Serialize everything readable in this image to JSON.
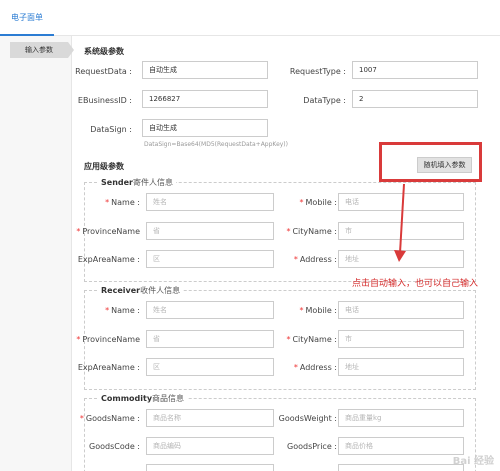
{
  "topbar": {
    "tab": "电子面单"
  },
  "leftnav": {
    "item": "输入参数"
  },
  "system": {
    "title": "系统级参数",
    "requestdata_label": "RequestData :",
    "requestdata_value": "自动生成",
    "requesttype_label": "RequestType :",
    "requesttype_value": "1007",
    "ebusinessid_label": "EBusinessID :",
    "ebusinessid_value": "1266827",
    "datatype_label": "DataType :",
    "datatype_value": "2",
    "datasign_label": "DataSign :",
    "datasign_value": "自动生成",
    "datasign_hint": "DataSign=Base64(MD5(RequestData+AppKey))"
  },
  "app": {
    "title": "应用级参数",
    "random_button": "随机填入参数"
  },
  "sender": {
    "legend_bold": "Sender",
    "legend_rest": "寄件人信息",
    "name_label": "Name :",
    "name_placeholder": "姓名",
    "mobile_label": "Mobile :",
    "mobile_placeholder": "电话",
    "province_label": "ProvinceName",
    "province_placeholder": "省",
    "city_label": "CityName :",
    "city_placeholder": "市",
    "exparea_label": "ExpAreaName :",
    "exparea_placeholder": "区",
    "address_label": "Address :",
    "address_placeholder": "地址"
  },
  "receiver": {
    "legend_bold": "Receiver",
    "legend_rest": "收件人信息",
    "name_label": "Name :",
    "name_placeholder": "姓名",
    "mobile_label": "Mobile :",
    "mobile_placeholder": "电话",
    "province_label": "ProvinceName",
    "province_placeholder": "省",
    "city_label": "CityName :",
    "city_placeholder": "市",
    "exparea_label": "ExpAreaName :",
    "exparea_placeholder": "区",
    "address_label": "Address :",
    "address_placeholder": "地址"
  },
  "commodity": {
    "legend_bold": "Commodity",
    "legend_rest": "商品信息",
    "goodsname_label": "GoodsName :",
    "goodsname_placeholder": "商品名称",
    "goodsweight_label": "GoodsWeight :",
    "goodsweight_placeholder": "商品重量kg",
    "goodscode_label": "GoodsCode :",
    "goodscode_placeholder": "商品编码",
    "goodsprice_label": "GoodsPrice :",
    "goodsprice_placeholder": "商品价格"
  },
  "annotation": {
    "text": "点击自动输入，也可以自己输入",
    "color": "#d52b2b"
  },
  "watermark": {
    "text": "Bai 经验"
  },
  "colors": {
    "accent": "#2b7cd3",
    "required": "#ee3333",
    "annotation_box": "#d93a3a"
  }
}
